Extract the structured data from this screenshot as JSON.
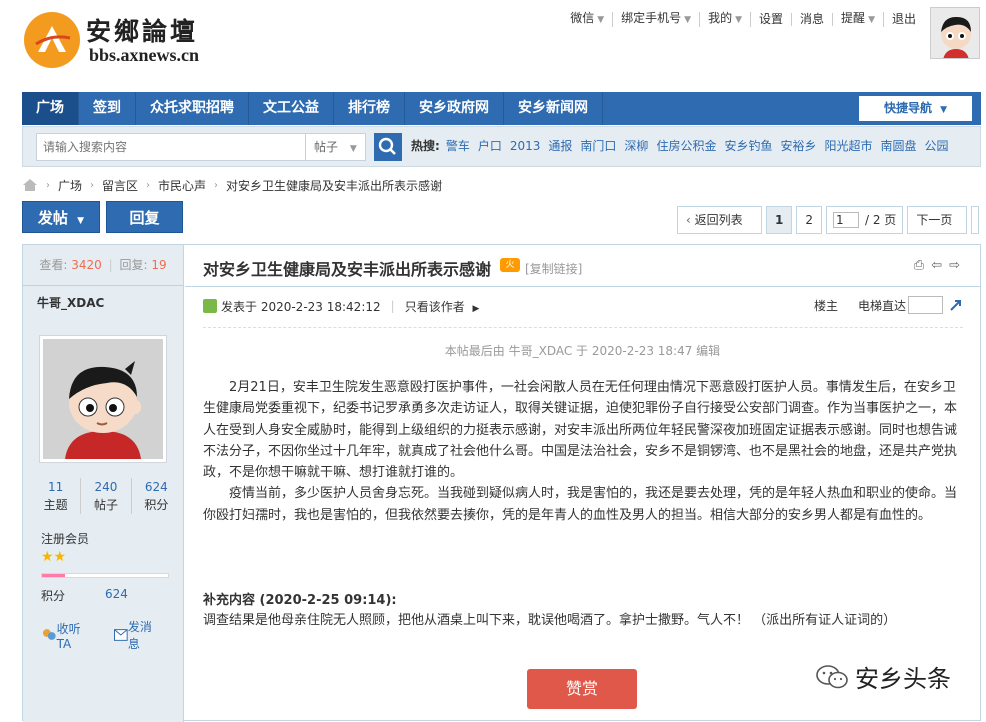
{
  "header": {
    "site_title": "安鄉論壇",
    "site_url": "bbs.axnews.cn",
    "user_links": [
      {
        "label": "微信",
        "dropdown": true
      },
      {
        "label": "绑定手机号",
        "dropdown": true
      },
      {
        "label": "我的",
        "dropdown": true
      },
      {
        "label": "设置",
        "dropdown": false
      },
      {
        "label": "消息",
        "dropdown": false
      },
      {
        "label": "提醒",
        "dropdown": true
      },
      {
        "label": "退出",
        "dropdown": false
      }
    ]
  },
  "nav": {
    "items": [
      "广场",
      "签到",
      "众托求职招聘",
      "文工公益",
      "排行榜",
      "安乡政府网",
      "安乡新闻网"
    ],
    "quick_nav": "快捷导航"
  },
  "search": {
    "placeholder": "请输入搜索内容",
    "type": "帖子",
    "hot_label": "热搜:",
    "hot_items": [
      "警车",
      "户口",
      "2013",
      "通报",
      "南门口",
      "深柳",
      "住房公积金",
      "安乡钓鱼",
      "安裕乡",
      "阳光超市",
      "南圆盘",
      "公园"
    ]
  },
  "breadcrumb": [
    "广场",
    "留言区",
    "市民心声",
    "对安乡卫生健康局及安丰派出所表示感谢"
  ],
  "actions": {
    "post": "发帖",
    "reply": "回复"
  },
  "pager": {
    "back": "返回列表",
    "pages": [
      "1",
      "2"
    ],
    "current_input": "1",
    "total": "/ 2 页",
    "next": "下一页"
  },
  "sidebar": {
    "views_label": "查看:",
    "views": "3420",
    "replies_label": "回复:",
    "replies": "19",
    "author": "牛哥_XDAC",
    "stats": [
      {
        "n": "11",
        "l": "主题"
      },
      {
        "n": "240",
        "l": "帖子"
      },
      {
        "n": "624",
        "l": "积分"
      }
    ],
    "group": "注册会员",
    "stars": "★★",
    "level_progress": 0.18,
    "credit_label": "积分",
    "credit_value": "624",
    "follow": "收听TA",
    "message": "发消息"
  },
  "post": {
    "title": "对安乡卫生健康局及安丰派出所表示感谢",
    "badge": "火",
    "copy_link": "[复制链接]",
    "posted_at": "发表于 2020-2-23 18:42:12",
    "only_author": "只看该作者",
    "floor": "楼主",
    "elevator": "电梯直达",
    "edited": "本帖最后由 牛哥_XDAC 于 2020-2-23 18:47 编辑",
    "paragraph1": "2月21日，安丰卫生院发生恶意殴打医护事件，一社会闲散人员在无任何理由情况下恶意殴打医护人员。事情发生后，在安乡卫生健康局党委重视下，纪委书记罗承勇多次走访证人，取得关键证据，迫使犯罪份子自行接受公安部门调查。作为当事医护之一，本人在受到人身安全威胁时，能得到上级组织的力挺表示感谢，对安丰派出所两位年轻民警深夜加班固定证据表示感谢。同时也想告诫不法分子，不因你坐过十几年牢，就真成了社会他什么哥。中国是法治社会，安乡不是铜锣湾、也不是黑社会的地盘，还是共产党执政，不是你想干嘛就干嘛、想打谁就打谁的。",
    "paragraph2": "疫情当前，多少医护人员舍身忘死。当我碰到疑似病人时，我是害怕的，我还是要去处理，凭的是年轻人热血和职业的使命。当你殴打妇孺时，我也是害怕的，但我依然要去揍你，凭的是年青人的血性及男人的担当。相信大部分的安乡男人都是有血性的。",
    "supplement_title": "补充内容 (2020-2-25 09:14):",
    "supplement_text": "调查结果是他母亲住院无人照顾，把他从酒桌上叫下来，耽误他喝酒了。拿护士撒野。气人不！ （派出所有证人证词的）",
    "reward": "赞赏",
    "watermark": "安乡头条"
  }
}
